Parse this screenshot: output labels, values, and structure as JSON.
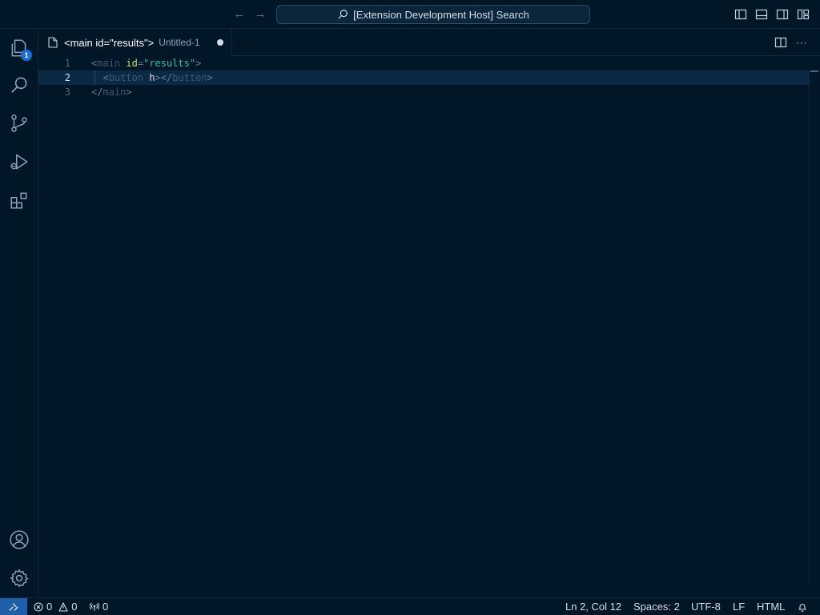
{
  "titlebar": {
    "back_icon": "arrow-left-icon",
    "forward_icon": "arrow-right-icon",
    "search_text": "[Extension Development Host] Search",
    "layout_icons": [
      "toggle-primary-sidebar-icon",
      "toggle-panel-icon",
      "toggle-secondary-sidebar-icon",
      "customize-layout-icon"
    ]
  },
  "activitybar": {
    "items": [
      {
        "name": "explorer-icon",
        "badge": "1"
      },
      {
        "name": "search-icon"
      },
      {
        "name": "source-control-icon"
      },
      {
        "name": "run-debug-icon"
      },
      {
        "name": "extensions-icon"
      }
    ],
    "bottom": [
      {
        "name": "accounts-icon"
      },
      {
        "name": "manage-gear-icon"
      }
    ]
  },
  "tab": {
    "title": "<main id=\"results\">",
    "description": "Untitled-1",
    "dirty": true
  },
  "editor": {
    "line_numbers": [
      "1",
      "2",
      "3"
    ],
    "lines": [
      [
        {
          "t": "<",
          "c": "punct"
        },
        {
          "t": "main",
          "c": "tag"
        },
        {
          "t": " ",
          "c": "text"
        },
        {
          "t": "id",
          "c": "attr"
        },
        {
          "t": "=",
          "c": "punct"
        },
        {
          "t": "\"results\"",
          "c": "str"
        },
        {
          "t": ">",
          "c": "punct"
        }
      ],
      [
        {
          "t": "  ",
          "c": "text"
        },
        {
          "t": "<",
          "c": "punct"
        },
        {
          "t": "button",
          "c": "tag"
        },
        {
          "t": " ",
          "c": "text"
        },
        {
          "t": "h",
          "c": "text"
        },
        {
          "t": "></",
          "c": "punct"
        },
        {
          "t": "button",
          "c": "tag"
        },
        {
          "t": ">",
          "c": "punct"
        }
      ],
      [
        {
          "t": "</",
          "c": "punct"
        },
        {
          "t": "main",
          "c": "tag"
        },
        {
          "t": ">",
          "c": "punct"
        }
      ]
    ],
    "current_line": 2
  },
  "statusbar": {
    "errors": "0",
    "warnings": "0",
    "ports": "0",
    "position": "Ln 2, Col 12",
    "spaces": "Spaces: 2",
    "encoding": "UTF-8",
    "eol": "LF",
    "language": "HTML"
  },
  "colors": {
    "background": "#011627",
    "accent": "#1d5fa8",
    "string": "#21c7a8",
    "attribute": "#c5e478"
  }
}
